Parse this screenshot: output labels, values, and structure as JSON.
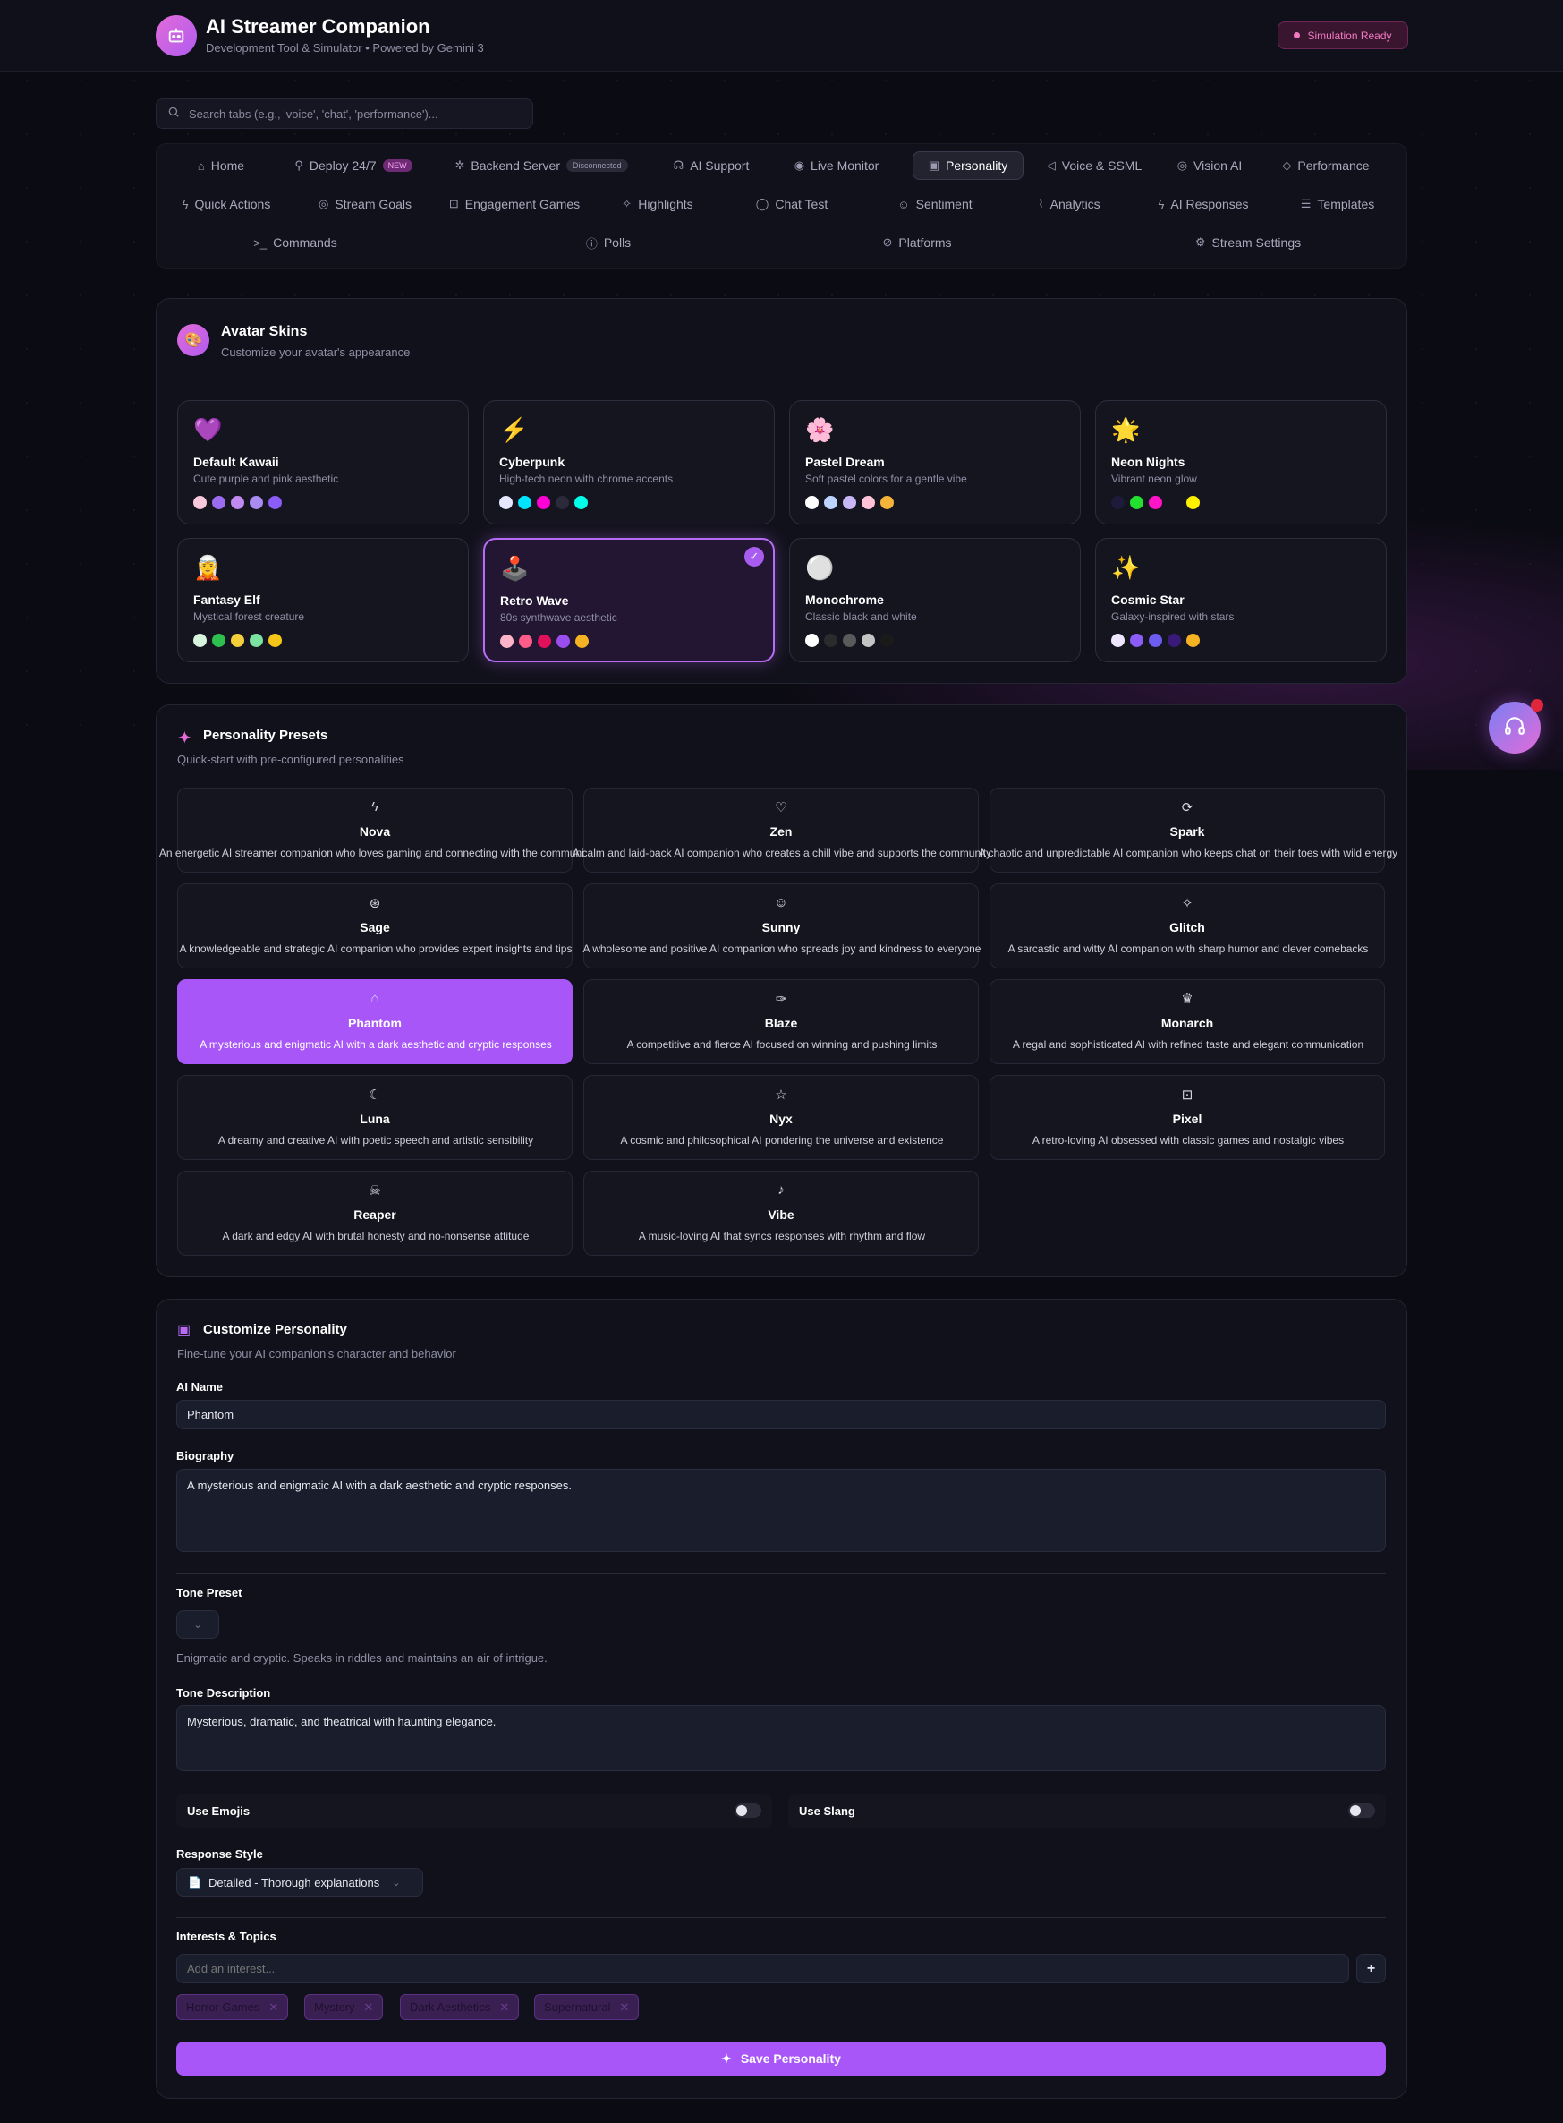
{
  "header": {
    "title": "AI Streamer Companion",
    "subtitle": "Development Tool & Simulator • Powered by Gemini 3",
    "status": "Simulation Ready"
  },
  "search": {
    "placeholder": "Search tabs (e.g., 'voice', 'chat', 'performance')..."
  },
  "tabs": {
    "home": "Home",
    "deploy": "Deploy 24/7",
    "deploy_badge": "NEW",
    "backend": "Backend Server",
    "backend_badge": "Disconnected",
    "support": "AI Support",
    "monitor": "Live Monitor",
    "personality": "Personality",
    "voice": "Voice & SSML",
    "vision": "Vision AI",
    "performance": "Performance",
    "quick": "Quick Actions",
    "goals": "Stream Goals",
    "games": "Engagement Games",
    "highlights": "Highlights",
    "chat": "Chat Test",
    "sentiment": "Sentiment",
    "analytics": "Analytics",
    "responses": "AI Responses",
    "templates": "Templates",
    "commands": "Commands",
    "polls": "Polls",
    "platforms": "Platforms",
    "settings": "Stream Settings"
  },
  "skins": {
    "title": "Avatar Skins",
    "subtitle": "Customize your avatar's appearance",
    "items": [
      {
        "emoji": "💜",
        "name": "Default Kawaii",
        "desc": "Cute purple and pink aesthetic",
        "colors": [
          "#f9c8dc",
          "#9b6cf0",
          "#c08af0",
          "#a98bf2",
          "#8b5cf6"
        ]
      },
      {
        "emoji": "⚡",
        "name": "Cyberpunk",
        "desc": "High-tech neon with chrome accents",
        "colors": [
          "#e6e6ff",
          "#00e5ff",
          "#ff00d4",
          "#2a2a3a",
          "#00ffea"
        ]
      },
      {
        "emoji": "🌸",
        "name": "Pastel Dream",
        "desc": "Soft pastel colors for a gentle vibe",
        "colors": [
          "#ffffff",
          "#bcd4ff",
          "#c7b8f5",
          "#ffc2d6",
          "#f5b339"
        ]
      },
      {
        "emoji": "🌟",
        "name": "Neon Nights",
        "desc": "Vibrant neon glow",
        "colors": [
          "#1e1b3a",
          "#22e22f",
          "#ff14c8",
          "#15151f",
          "#fff000"
        ]
      },
      {
        "emoji": "🧝",
        "name": "Fantasy Elf",
        "desc": "Mystical forest creature",
        "colors": [
          "#d6f5dc",
          "#2dc04f",
          "#f5cf3a",
          "#7be3a2",
          "#f5c518"
        ]
      },
      {
        "emoji": "🕹️",
        "name": "Retro Wave",
        "desc": "80s synthwave aesthetic",
        "colors": [
          "#ffb3c8",
          "#ff5c8a",
          "#e0105a",
          "#9b4ef0",
          "#f5b323"
        ]
      },
      {
        "emoji": "⚪",
        "name": "Monochrome",
        "desc": "Classic black and white",
        "colors": [
          "#ffffff",
          "#2b2b2b",
          "#5a5a5a",
          "#c4c4c4",
          "#1a1a1a"
        ]
      },
      {
        "emoji": "✨",
        "name": "Cosmic Star",
        "desc": "Galaxy-inspired with stars",
        "colors": [
          "#eee6ff",
          "#8b5cf6",
          "#6d5cf0",
          "#3a1a78",
          "#f5b323"
        ]
      }
    ]
  },
  "presets": {
    "title": "Personality Presets",
    "subtitle": "Quick-start with pre-configured personalities",
    "items": [
      {
        "icon": "ϟ",
        "name": "Nova",
        "desc": "An energetic AI streamer companion who loves gaming and connecting with the community"
      },
      {
        "icon": "♡",
        "name": "Zen",
        "desc": "A calm and laid-back AI companion who creates a chill vibe and supports the community"
      },
      {
        "icon": "⟳",
        "name": "Spark",
        "desc": "A chaotic and unpredictable AI companion who keeps chat on their toes with wild energy"
      },
      {
        "icon": "⊛",
        "name": "Sage",
        "desc": "A knowledgeable and strategic AI companion who provides expert insights and tips"
      },
      {
        "icon": "☺",
        "name": "Sunny",
        "desc": "A wholesome and positive AI companion who spreads joy and kindness to everyone"
      },
      {
        "icon": "✧",
        "name": "Glitch",
        "desc": "A sarcastic and witty AI companion with sharp humor and clever comebacks"
      },
      {
        "icon": "⌂",
        "name": "Phantom",
        "desc": "A mysterious and enigmatic AI with a dark aesthetic and cryptic responses"
      },
      {
        "icon": "✑",
        "name": "Blaze",
        "desc": "A competitive and fierce AI focused on winning and pushing limits"
      },
      {
        "icon": "♛",
        "name": "Monarch",
        "desc": "A regal and sophisticated AI with refined taste and elegant communication"
      },
      {
        "icon": "☾",
        "name": "Luna",
        "desc": "A dreamy and creative AI with poetic speech and artistic sensibility"
      },
      {
        "icon": "☆",
        "name": "Nyx",
        "desc": "A cosmic and philosophical AI pondering the universe and existence"
      },
      {
        "icon": "⊡",
        "name": "Pixel",
        "desc": "A retro-loving AI obsessed with classic games and nostalgic vibes"
      },
      {
        "icon": "☠",
        "name": "Reaper",
        "desc": "A dark and edgy AI with brutal honesty and no-nonsense attitude"
      },
      {
        "icon": "♪",
        "name": "Vibe",
        "desc": "A music-loving AI that syncs responses with rhythm and flow"
      }
    ]
  },
  "customize": {
    "title": "Customize Personality",
    "subtitle": "Fine-tune your AI companion's character and behavior",
    "name_label": "AI Name",
    "name_value": "Phantom",
    "bio_label": "Biography",
    "bio_value": "A mysterious and enigmatic AI with a dark aesthetic and cryptic responses.",
    "tone_label": "Tone Preset",
    "tone_hint": "Enigmatic and cryptic. Speaks in riddles and maintains an air of intrigue.",
    "tone_desc_label": "Tone Description",
    "tone_desc_value": "Mysterious, dramatic, and theatrical with haunting elegance.",
    "emojis_label": "Use Emojis",
    "slang_label": "Use Slang",
    "style_label": "Response Style",
    "style_value": "Detailed - Thorough explanations",
    "interests_label": "Interests & Topics",
    "interest_placeholder": "Add an interest...",
    "add_label": "+",
    "interests": [
      "Horror Games",
      "Mystery",
      "Dark Aesthetics",
      "Supernatural"
    ],
    "save_label": "Save Personality"
  }
}
